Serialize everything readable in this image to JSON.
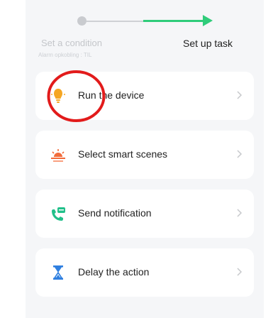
{
  "stepper": {
    "step1_label": "Set a condition",
    "step1_sub": "Alarm opkobling : TIL",
    "step2_label": "Set up task"
  },
  "actions": [
    {
      "label": "Run the device",
      "icon": "lightbulb-icon"
    },
    {
      "label": "Select smart scenes",
      "icon": "sunrise-icon"
    },
    {
      "label": "Send notification",
      "icon": "phone-message-icon"
    },
    {
      "label": "Delay the action",
      "icon": "hourglass-icon"
    }
  ],
  "colors": {
    "accent_green": "#2fcc7a",
    "highlight_red": "#e21b1b",
    "bulb_orange": "#f5a623",
    "scene_orange": "#f26b3a",
    "notify_green": "#22c08a",
    "hourglass_blue": "#2f7fe0"
  }
}
